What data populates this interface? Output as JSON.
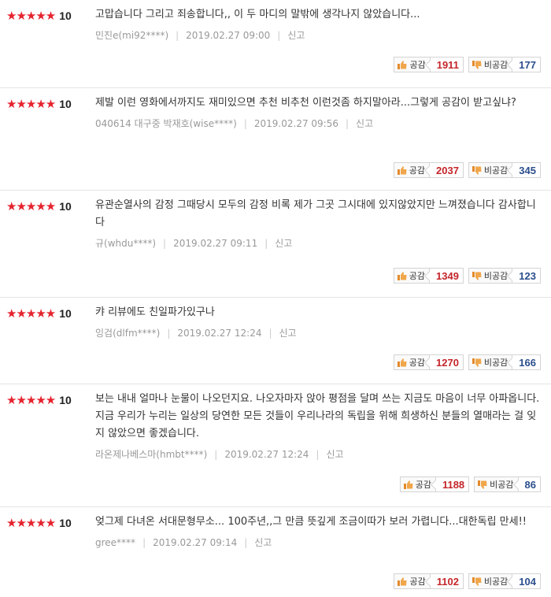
{
  "labels": {
    "like": "공감",
    "dislike": "비공감",
    "report": "신고"
  },
  "colors": {
    "star": "#e5232e",
    "like_count": "#c4252a",
    "dislike_count": "#2b4e8c"
  },
  "reviews": [
    {
      "stars": "★★★★★",
      "score": "10",
      "text": "고맙습니다 그리고 죄송합니다,, 이 두 마디의 말밖에 생각나지 않았습니다...",
      "user": "민진e(mi92****)",
      "date": "2019.02.27 09:00",
      "likes": "1911",
      "dislikes": "177"
    },
    {
      "stars": "★★★★★",
      "score": "10",
      "text": "제발 이런 영화에서까지도 재미있으면 추천 비추천 이런것좀 하지말아라...그렇게 공감이 받고싶냐?",
      "user": "040614 대구중 박재호(wise****)",
      "date": "2019.02.27 09:56",
      "likes": "2037",
      "dislikes": "345"
    },
    {
      "stars": "★★★★★",
      "score": "10",
      "text": "유관순열사의 감정 그때당시 모두의 감정 비록 제가 그곳 그시대에 있지않았지만 느껴졌습니다 감사합니다",
      "user": "규(whdu****)",
      "date": "2019.02.27 09:11",
      "likes": "1349",
      "dislikes": "123"
    },
    {
      "stars": "★★★★★",
      "score": "10",
      "text": "캬 리뷰에도 친일파가있구나",
      "user": "잉검(dlfm****)",
      "date": "2019.02.27 12:24",
      "likes": "1270",
      "dislikes": "166"
    },
    {
      "stars": "★★★★★",
      "score": "10",
      "text": "보는 내내 얼마나 눈물이 나오던지요. 나오자마자 앉아 평점을 달며 쓰는 지금도 마음이 너무 아파옵니다. 지금 우리가 누리는 일상의 당연한 모든 것들이 우리나라의 독립을 위해 희생하신 분들의 열매라는 걸 잊지 않았으면 좋겠습니다.",
      "user": "라온제나베스마(hmbt****)",
      "date": "2019.02.27 12:24",
      "likes": "1188",
      "dislikes": "86"
    },
    {
      "stars": "★★★★★",
      "score": "10",
      "text": "엊그제 다녀온 서대문형무소... 100주년,,그 만큼 뜻깊게 조금이따가 보러 가렵니다...대한독립 만세!!",
      "user": "gree****",
      "date": "2019.02.27 09:14",
      "likes": "1102",
      "dislikes": "104"
    }
  ]
}
